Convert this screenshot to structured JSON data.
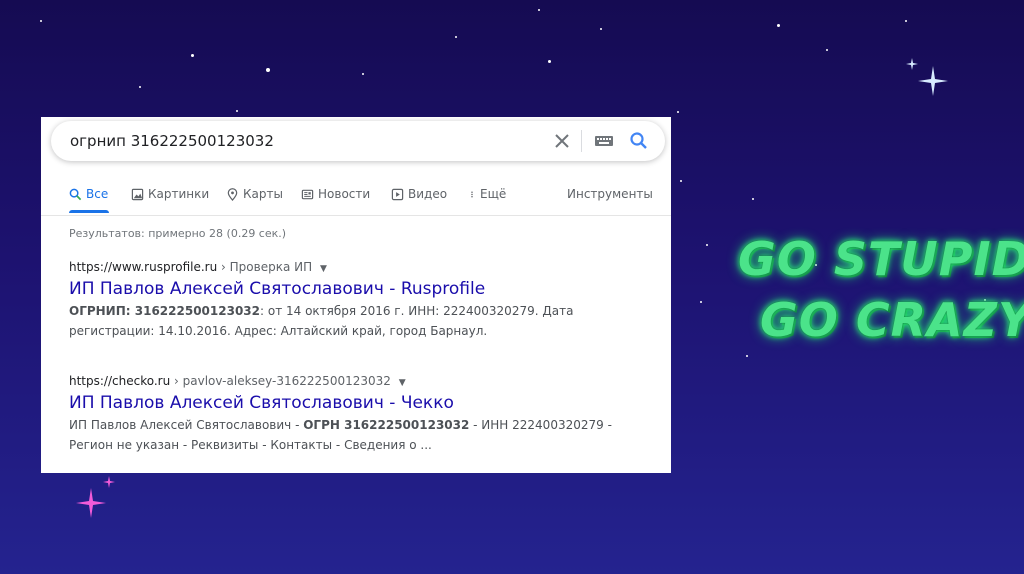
{
  "search": {
    "query": "огрнип 316222500123032",
    "clear_icon": "close-icon",
    "keyboard_icon": "keyboard-icon",
    "search_icon": "search-icon"
  },
  "tabs": [
    {
      "label": "Все",
      "icon": "search-icon",
      "active": true
    },
    {
      "label": "Картинки",
      "icon": "image-icon"
    },
    {
      "label": "Карты",
      "icon": "map-pin-icon"
    },
    {
      "label": "Новости",
      "icon": "news-icon"
    },
    {
      "label": "Видео",
      "icon": "play-icon"
    },
    {
      "label": "Ещё",
      "icon": "more-vertical-icon"
    }
  ],
  "tools_label": "Инструменты",
  "stats": "Результатов: примерно 28 (0.29 сек.)",
  "results": [
    {
      "site": "https://www.rusprofile.ru",
      "crumb": "› Проверка ИП",
      "title": "ИП Павлов Алексей Святославович - Rusprofile",
      "snippet_bold_1": "ОГРНИП: 316222500123032",
      "snippet_1": ": от 14 октября 2016 г. ИНН: 222400320279. Дата регистрации: 14.10.2016. Адрес: Алтайский край, город Барнаул."
    },
    {
      "site": "https://checko.ru",
      "crumb": "› pavlov-aleksey-316222500123032",
      "title": "ИП Павлов Алексей Святославович - Чекко",
      "snippet_pre": "ИП Павлов Алексей Святославович - ",
      "snippet_bold_1": "ОГРН 316222500123032",
      "snippet_1": " - ИНН 222400320279 - Регион не указан - Реквизиты - Контакты - Сведения о ..."
    }
  ],
  "neon_text": {
    "line1": "GO STUPID",
    "line2": "GO CRAZY",
    "color": "#4be38a"
  },
  "colors": {
    "background": "#1d1270",
    "link": "#1a0dab",
    "accent": "#1a73e8"
  }
}
